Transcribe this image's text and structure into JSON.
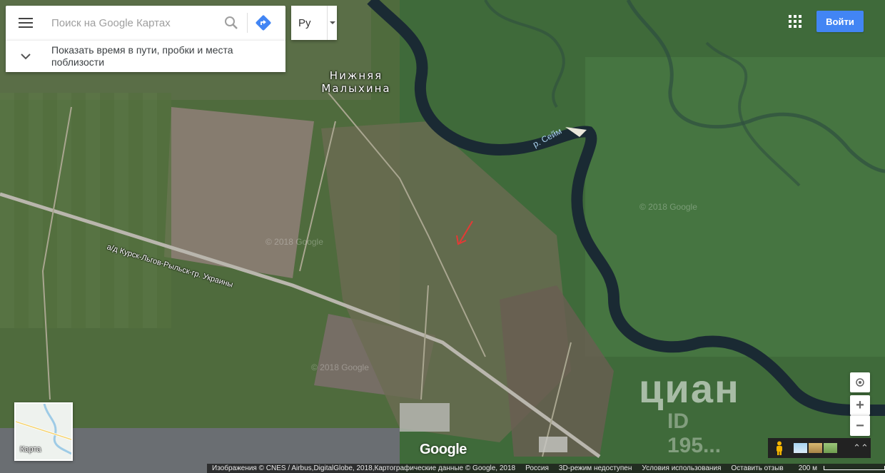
{
  "search": {
    "placeholder": "Поиск на Google Картах",
    "menu_icon": "hamburger-menu-icon",
    "search_icon": "search-icon",
    "directions_icon": "directions-icon"
  },
  "expander": {
    "label": "Показать время в пути, пробки и места поблизости"
  },
  "language": {
    "value": "Ру"
  },
  "header": {
    "login_label": "Войти",
    "apps_icon": "apps-grid-icon"
  },
  "map": {
    "place_label": "Нижняя Малыхина",
    "river_label": "р. Сейм",
    "road_label": "а/д Курск-Льгов-Рыльск-гр. Украины",
    "watermark": "© 2018 Google",
    "cian_logo": "циан",
    "cian_id": "ID 195..."
  },
  "minimap": {
    "label": "Карта"
  },
  "controls": {
    "zoom_in": "+",
    "zoom_out": "−",
    "expand": "⌃⌃"
  },
  "brand": {
    "logo": "Google"
  },
  "footer": {
    "imagery": "Изображения © CNES / Airbus,DigitalGlobe, 2018,Картографические данные © Google, 2018",
    "country": "Россия",
    "mode": "3D-режим недоступен",
    "terms": "Условия использования",
    "feedback": "Оставить отзыв",
    "scale": "200 м"
  },
  "colors": {
    "accent": "#4285f4",
    "river": "#1a2a33",
    "marker_arrow": "#e53935"
  }
}
